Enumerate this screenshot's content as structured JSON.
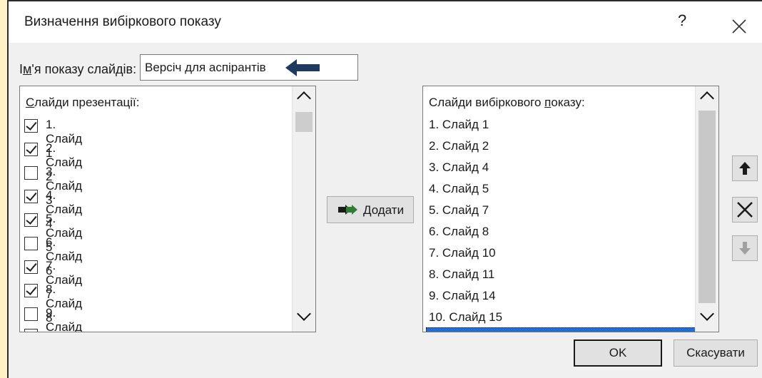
{
  "window": {
    "title": "Визначення вибіркового показу",
    "help_label": "?",
    "close_label": "✕"
  },
  "show_name": {
    "label_pre": "І",
    "label_accel": "м",
    "label_post": "'я показу слайдів:",
    "value": "Версіч для аспірантів"
  },
  "presentation_slides": {
    "header_accel": "С",
    "header_rest": "лайди презентації:",
    "items": [
      {
        "label": "1. Слайд 1",
        "checked": true
      },
      {
        "label": "2. Слайд 2",
        "checked": true
      },
      {
        "label": "3. Слайд 3",
        "checked": false
      },
      {
        "label": "4. Слайд 4",
        "checked": true
      },
      {
        "label": "5. Слайд 5",
        "checked": true
      },
      {
        "label": "6. Слайд 6",
        "checked": false
      },
      {
        "label": "7. Слайд 7",
        "checked": true
      },
      {
        "label": "8. Слайд 8",
        "checked": true
      },
      {
        "label": "9. Слайд 9",
        "checked": false
      }
    ]
  },
  "add_button": {
    "label_accel": "Д",
    "label_rest": "одати",
    "icon": "double-arrow-right-icon"
  },
  "custom_show_slides": {
    "header_pre": "Слайди вибіркового ",
    "header_accel": "п",
    "header_post": "оказу:",
    "items": [
      "1. Слайд 1",
      "2. Слайд 2",
      "3. Слайд 4",
      "4. Слайд 5",
      "5. Слайд 7",
      "6. Слайд 8",
      "7. Слайд 10",
      "8. Слайд 11",
      "9. Слайд 14",
      "10. Слайд 15"
    ]
  },
  "side_buttons": {
    "up_icon": "arrow-up-icon",
    "remove_icon": "remove-x-icon",
    "down_icon": "arrow-down-icon"
  },
  "footer": {
    "ok_label": "OK",
    "cancel_label": "Скасувати"
  },
  "colors": {
    "accent_arrow": "#1f3a5f",
    "selection": "#1e6fd9",
    "background_highlight": "#fff2c4"
  }
}
